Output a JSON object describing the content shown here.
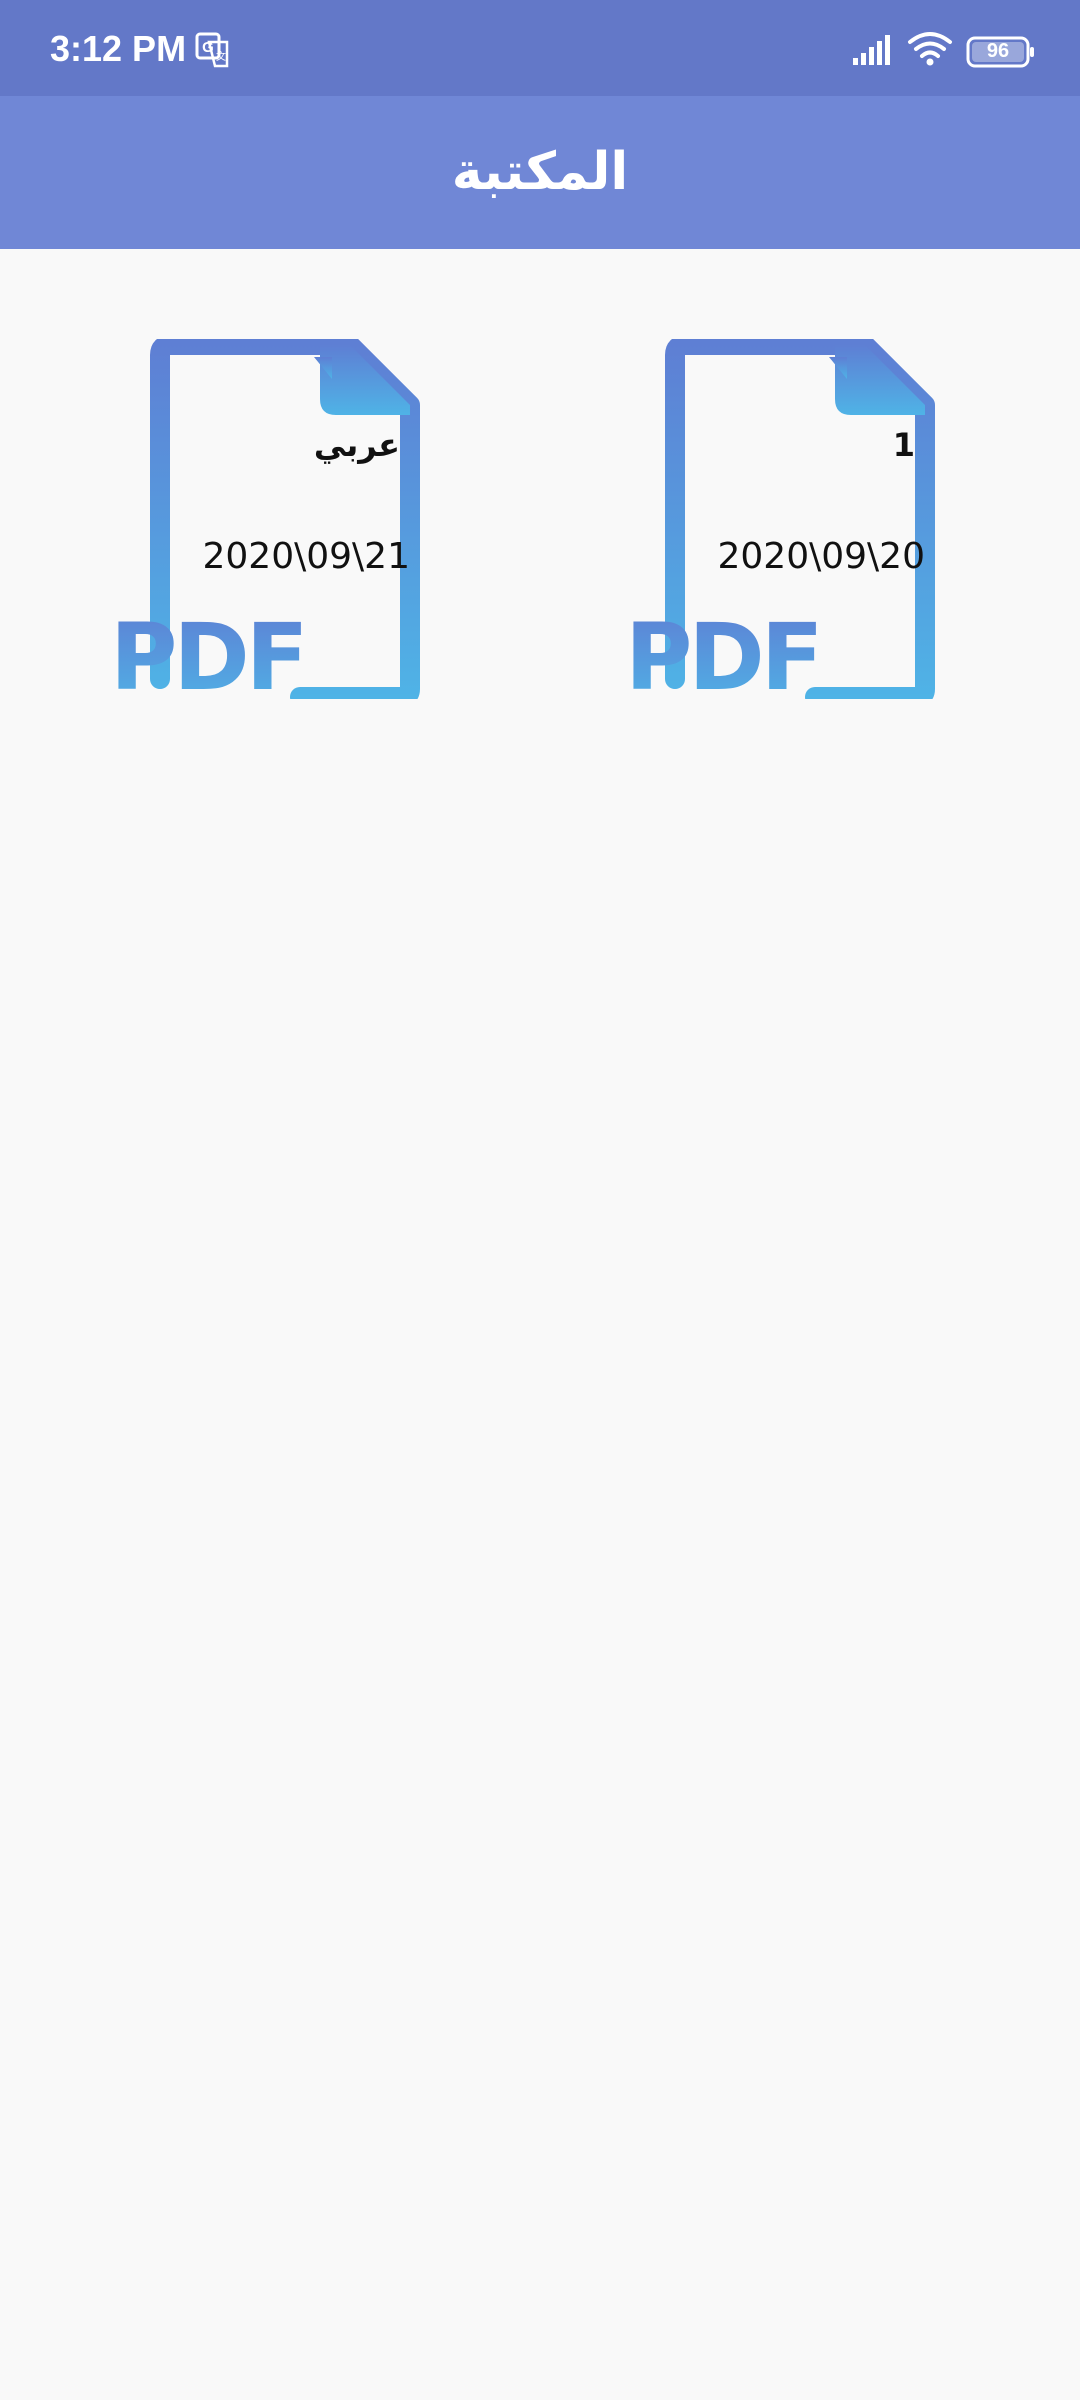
{
  "status_bar": {
    "time": "3:12 PM",
    "battery_level": "96",
    "icons": [
      "translate-icon",
      "signal-icon",
      "wifi-icon",
      "battery-icon"
    ]
  },
  "app_bar": {
    "title": "المكتبة"
  },
  "library": {
    "items": [
      {
        "name": "1",
        "date": "2020\\09\\20",
        "badge": "PDF",
        "icon": "pdf-file-icon"
      },
      {
        "name": "عربي",
        "date": "2020\\09\\21",
        "badge": "PDF",
        "icon": "pdf-file-icon"
      }
    ]
  },
  "colors": {
    "status_bar": "#6378c8",
    "app_bar": "#7087d6",
    "background": "#f9f9f9",
    "icon_gradient_top": "#5e7fd4",
    "icon_gradient_bottom": "#4fb3e6"
  }
}
